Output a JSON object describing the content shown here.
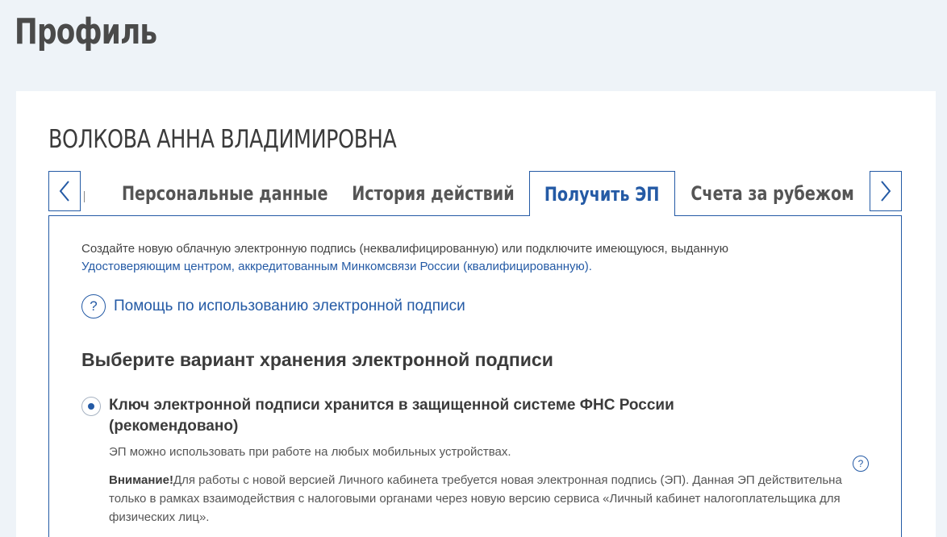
{
  "page": {
    "title": "Профиль"
  },
  "profile": {
    "name": "ВОЛКОВА АННА ВЛАДИМИРОВНА"
  },
  "tabs": [
    {
      "label": "Персональные данные",
      "active": false
    },
    {
      "label": "История действий",
      "active": false
    },
    {
      "label": "Получить ЭП",
      "active": true
    },
    {
      "label": "Счета за рубежом",
      "active": false
    }
  ],
  "panel": {
    "intro_text": "Создайте новую облачную электронную подпись (неквалифицированную) или подключите имеющуюся, выданную",
    "intro_link": "Удостоверяющим центром, аккредитованным Минкомсвязи России (квалифицированную).",
    "help_link": "Помощь по использованию электронной подписи",
    "help_icon_symbol": "?",
    "section_title": "Выберите вариант хранения электронной подписи",
    "option": {
      "title": "Ключ электронной подписи хранится в защищенной системе ФНС России (рекомендовано)",
      "selected": true,
      "description": "ЭП можно использовать при работе на любых мобильных устройствах.",
      "warning_label": "Внимание!",
      "warning_text": "Для работы с новой версией Личного кабинета требуется новая электронная подпись (ЭП). Данная ЭП действительна только в рамках взаимодействия с налоговыми органами через новую версию сервиса  «Личный кабинет налогоплательщика для физических лиц».",
      "info_icon_symbol": "?"
    }
  },
  "colors": {
    "accent": "#245aa5",
    "background": "#eef3f8",
    "text": "#3b3b3b"
  }
}
